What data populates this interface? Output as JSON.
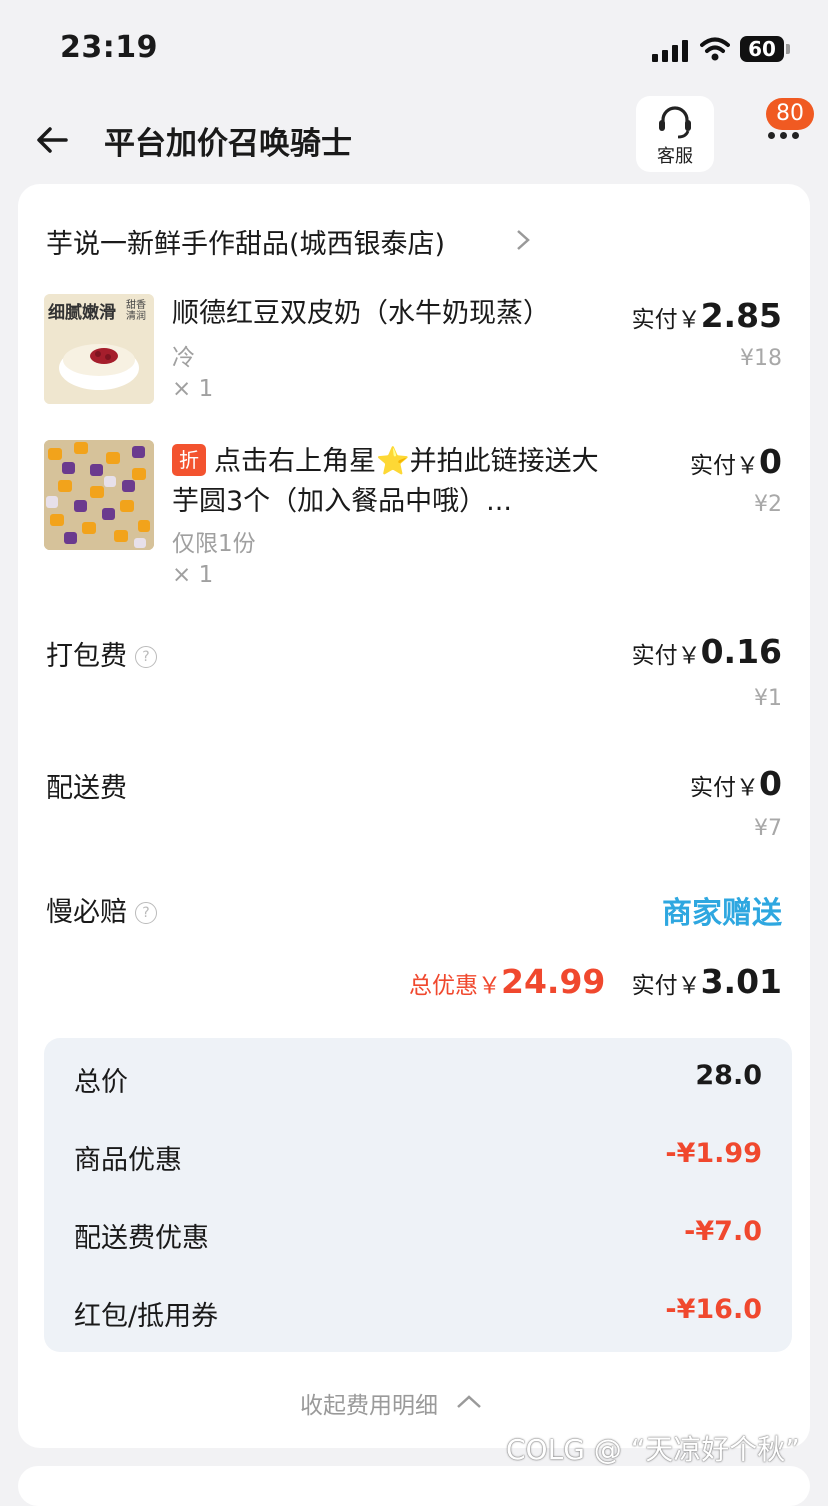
{
  "status_bar": {
    "time": "23:19",
    "battery": "60"
  },
  "nav": {
    "title": "平台加价召唤骑士",
    "service_label": "客服",
    "badge": "80"
  },
  "shop": {
    "name": "芋说一新鲜手作甜品(城西银泰店)"
  },
  "items": [
    {
      "thumb_text": "细腻嫩滑",
      "thumb_sub": "甜香清润",
      "name": "顺德红豆双皮奶（水牛奶现蒸）",
      "spec": "冷",
      "qty": "× 1",
      "pay_label": "实付￥",
      "pay": "2.85",
      "original": "¥18"
    },
    {
      "tag": "折",
      "name_line1": "点击右上角星⭐并拍此链接送大",
      "name_line2": "芋圆3个（加入餐品中哦）...",
      "limit": "仅限1份",
      "qty": "× 1",
      "pay_label": "实付￥",
      "pay": "0",
      "original": "¥2"
    }
  ],
  "fees": {
    "packing": {
      "label": "打包费",
      "pay_label": "实付￥",
      "pay": "0.16",
      "original": "¥1"
    },
    "delivery": {
      "label": "配送费",
      "pay_label": "实付￥",
      "pay": "0",
      "original": "¥7"
    },
    "slow_comp": {
      "label": "慢必赔",
      "value": "商家赠送"
    }
  },
  "summary": {
    "discount_label": "总优惠￥",
    "discount": "24.99",
    "pay_label": "实付￥",
    "pay": "3.01"
  },
  "breakdown": [
    {
      "label": "总价",
      "value": "28.0",
      "red": false
    },
    {
      "label": "商品优惠",
      "value": "-¥1.99",
      "red": true
    },
    {
      "label": "配送费优惠",
      "value": "-¥7.0",
      "red": true
    },
    {
      "label": "红包/抵用券",
      "value": "-¥16.0",
      "red": true
    }
  ],
  "collapse_label": "收起费用明细",
  "watermark": "COLG @ “天凉好个秋”",
  "colors": {
    "accent_red": "#f0482e",
    "gift_blue": "#2ea7e0",
    "badge_orange": "#f05a22"
  }
}
